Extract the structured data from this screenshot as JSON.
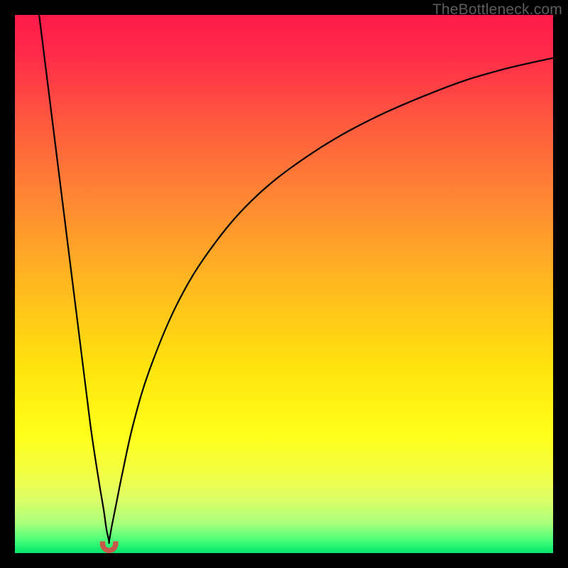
{
  "watermark": {
    "text": "TheBottleneck.com"
  },
  "chart_data": {
    "type": "line",
    "title": "",
    "xlabel": "",
    "ylabel": "",
    "xlim": [
      0,
      100
    ],
    "ylim": [
      0,
      100
    ],
    "background_gradient": {
      "stops": [
        {
          "offset": 0.0,
          "color": "#ff1a4b"
        },
        {
          "offset": 0.08,
          "color": "#ff2d49"
        },
        {
          "offset": 0.2,
          "color": "#ff5a3f"
        },
        {
          "offset": 0.35,
          "color": "#ff8a33"
        },
        {
          "offset": 0.5,
          "color": "#ffb81f"
        },
        {
          "offset": 0.65,
          "color": "#ffe20e"
        },
        {
          "offset": 0.78,
          "color": "#ffff1a"
        },
        {
          "offset": 0.86,
          "color": "#f2ff4a"
        },
        {
          "offset": 0.905,
          "color": "#d8ff6a"
        },
        {
          "offset": 0.945,
          "color": "#a8ff7a"
        },
        {
          "offset": 0.975,
          "color": "#4dff7a"
        },
        {
          "offset": 1.0,
          "color": "#00e66b"
        }
      ]
    },
    "optimum_x": 17.5,
    "bottom_marker": {
      "x": 17.5,
      "y": 97.8,
      "width_pct": 3.4,
      "height_pct": 2.2,
      "color": "#c65a4a"
    },
    "series": [
      {
        "name": "left-branch",
        "x": [
          4.5,
          6,
          8,
          10,
          12,
          14,
          15.5,
          16.5,
          17.0,
          17.5
        ],
        "y": [
          0,
          12,
          28,
          44,
          60,
          76,
          86,
          92,
          95.5,
          97.8
        ]
      },
      {
        "name": "right-branch",
        "x": [
          17.5,
          18.0,
          18.8,
          20,
          22,
          25,
          30,
          36,
          44,
          54,
          66,
          80,
          90,
          100
        ],
        "y": [
          97.8,
          95.0,
          91.0,
          85.0,
          76.0,
          66.0,
          54.0,
          44.0,
          34.5,
          26.5,
          19.5,
          13.5,
          10.3,
          8.0
        ]
      }
    ]
  }
}
